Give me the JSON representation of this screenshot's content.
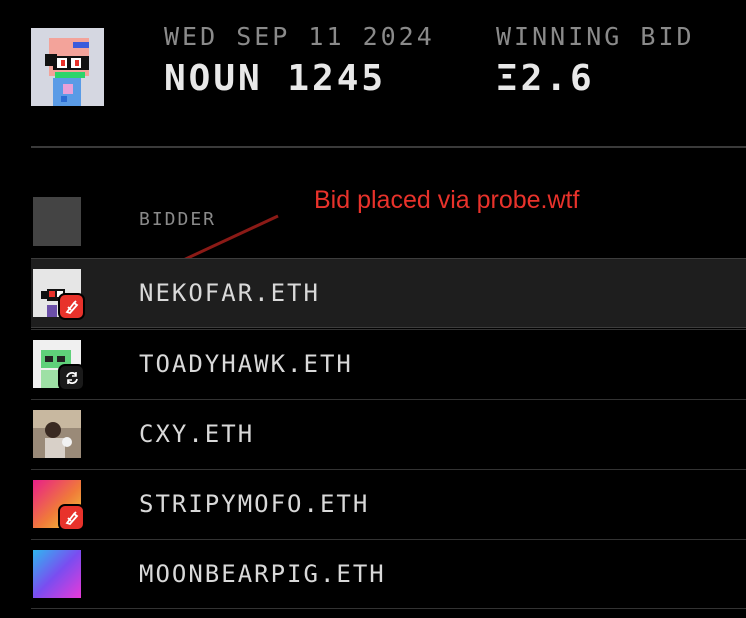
{
  "auction": {
    "date": "WED SEP 11 2024",
    "noun_title": "NOUN 1245",
    "winning_bid_label": "WINNING BID",
    "winning_bid_value": "Ξ2.6"
  },
  "table": {
    "bidder_header": "BIDDER"
  },
  "annotation": {
    "text": "Bid placed via probe.wtf",
    "color": "#e8322b"
  },
  "bidders": [
    {
      "name": "NEKOFAR.ETH",
      "badge": "probe-icon",
      "highlighted": true
    },
    {
      "name": "TOADYHAWK.ETH",
      "badge": "swap-icon",
      "highlighted": false
    },
    {
      "name": "CXY.ETH",
      "badge": "",
      "highlighted": false
    },
    {
      "name": "STRIPYMOFO.ETH",
      "badge": "probe-icon",
      "highlighted": false
    },
    {
      "name": "MOONBEARPIG.ETH",
      "badge": "",
      "highlighted": false
    }
  ]
}
